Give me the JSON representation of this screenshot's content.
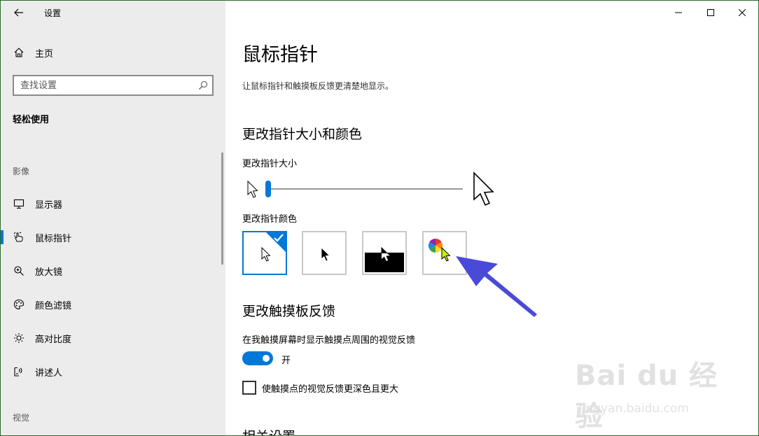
{
  "app": {
    "title": "设置"
  },
  "sidebar": {
    "home_label": "主页",
    "search_placeholder": "查找设置",
    "section_title": "轻松使用",
    "group_vision": "影像",
    "items": [
      {
        "label": "显示器",
        "icon": "monitor-icon"
      },
      {
        "label": "鼠标指针",
        "icon": "mouse-pointer-hand-icon",
        "active": true
      },
      {
        "label": "放大镜",
        "icon": "magnifier-icon"
      },
      {
        "label": "颜色滤镜",
        "icon": "palette-icon"
      },
      {
        "label": "高对比度",
        "icon": "sun-icon"
      },
      {
        "label": "讲述人",
        "icon": "narrator-icon"
      }
    ],
    "group_hearing": "视觉"
  },
  "main": {
    "title": "鼠标指针",
    "description": "让鼠标指针和触摸板反馈更清楚地显示。",
    "section_size_color": "更改指针大小和颜色",
    "size_label": "更改指针大小",
    "pointer_size": 1,
    "color_label": "更改指针颜色",
    "color_options": [
      {
        "name": "white",
        "selected": true
      },
      {
        "name": "black",
        "selected": false
      },
      {
        "name": "inverted",
        "selected": false
      },
      {
        "name": "custom",
        "selected": false
      }
    ],
    "section_touch": "更改触摸板反馈",
    "touch_feedback_label": "在我触摸屏幕时显示触摸点周围的视觉反馈",
    "toggle_state": "开",
    "darker_feedback_label": "使触摸点的视觉反馈更深色且更大",
    "section_related": "相关设置"
  },
  "watermark": {
    "brand": "Bai du 经验",
    "url": "jingyan.baidu.com"
  },
  "colors": {
    "accent": "#0078d7",
    "annotation_arrow": "#4a4ad8"
  }
}
